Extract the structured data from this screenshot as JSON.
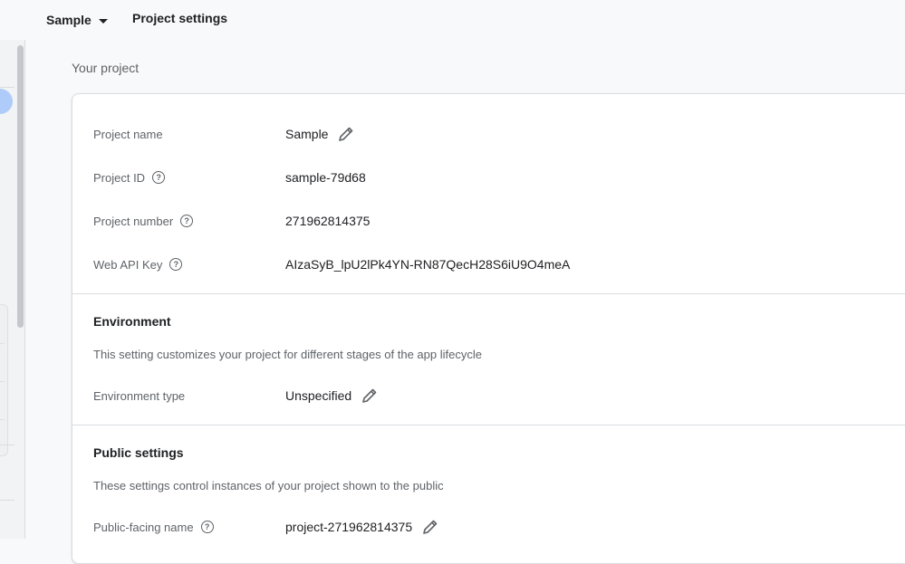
{
  "topbar": {
    "project_name": "Sample",
    "page_title": "Project settings"
  },
  "section_title": "Your project",
  "project_info": {
    "rows": [
      {
        "label": "Project name",
        "value": "Sample"
      },
      {
        "label": "Project ID",
        "value": "sample-79d68"
      },
      {
        "label": "Project number",
        "value": "271962814375"
      },
      {
        "label": "Web API Key",
        "value": "AIzaSyB_lpU2lPk4YN-RN87QecH28S6iU9O4meA"
      }
    ]
  },
  "environment": {
    "title": "Environment",
    "description": "This setting customizes your project for different stages of the app lifecycle",
    "type_label": "Environment type",
    "type_value": "Unspecified"
  },
  "public_settings": {
    "title": "Public settings",
    "description": "These settings control instances of your project shown to the public",
    "name_label": "Public-facing name",
    "name_value": "project-271962814375"
  },
  "icons": {
    "help": "help-circle-icon",
    "edit": "pencil-edit-icon",
    "dropdown": "caret-down-icon"
  },
  "colors": {
    "accent": "#aecbfa",
    "text_primary": "#202124",
    "text_secondary": "#5f6368"
  }
}
